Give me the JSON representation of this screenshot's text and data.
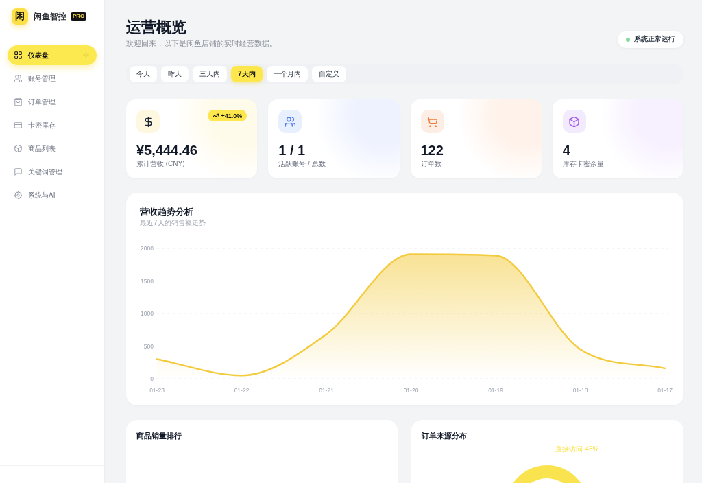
{
  "sidebar": {
    "logo_mark": "闲",
    "brand": "闲鱼智控",
    "badge": "PRO",
    "items": [
      {
        "label": "仪表盘",
        "kind": "dashboard",
        "selected": true
      },
      {
        "label": "账号管理",
        "kind": "accounts",
        "selected": false
      },
      {
        "label": "订单管理",
        "kind": "orders",
        "selected": false
      },
      {
        "label": "卡密库存",
        "kind": "cards",
        "selected": false
      },
      {
        "label": "商品列表",
        "kind": "products",
        "selected": false
      },
      {
        "label": "关键词管理",
        "kind": "keywords",
        "selected": false
      },
      {
        "label": "系统与AI",
        "kind": "settings",
        "selected": false
      }
    ]
  },
  "header": {
    "title": "运营概览",
    "subtitle": "欢迎回来，以下是闲鱼店铺的实时经营数据。",
    "status": {
      "label": "系统正常运行",
      "ok": true
    }
  },
  "date_tabs": [
    {
      "label": "今天",
      "selected": false
    },
    {
      "label": "昨天",
      "selected": false
    },
    {
      "label": "三天内",
      "selected": false
    },
    {
      "label": "7天内",
      "selected": true
    },
    {
      "label": "一个月内",
      "selected": false
    },
    {
      "label": "自定义",
      "selected": false
    }
  ],
  "stat_cards": [
    {
      "kind": "revenue",
      "value": "¥5,444.46",
      "label": "累计营收 (CNY)",
      "badge": "+41.0%"
    },
    {
      "kind": "accounts",
      "value": "1 / 1",
      "label": "活跃账号 / 总数"
    },
    {
      "kind": "orders",
      "value": "122",
      "label": "订单数"
    },
    {
      "kind": "stock",
      "value": "4",
      "label": "库存卡密余量"
    }
  ],
  "revenue_chart": {
    "title": "营收趋势分析",
    "subtitle": "最近7天的销售额走势",
    "chart_data": {
      "type": "area",
      "categories": [
        "01-23",
        "01-22",
        "01-21",
        "01-20",
        "01-19",
        "01-18",
        "01-17"
      ],
      "series": [
        {
          "color": "#f3cb3e",
          "values": [
            300,
            50,
            680,
            1910,
            1890,
            450,
            160
          ]
        }
      ],
      "ylim": [
        0,
        2000
      ],
      "yticks": [
        0,
        500,
        1000,
        1500,
        2000
      ],
      "grid": true
    }
  },
  "product_ranking": {
    "title": "商品销量排行"
  },
  "order_sources": {
    "title": "订单来源分布",
    "slice_label": "直接访问",
    "slice_value": "45%"
  }
}
